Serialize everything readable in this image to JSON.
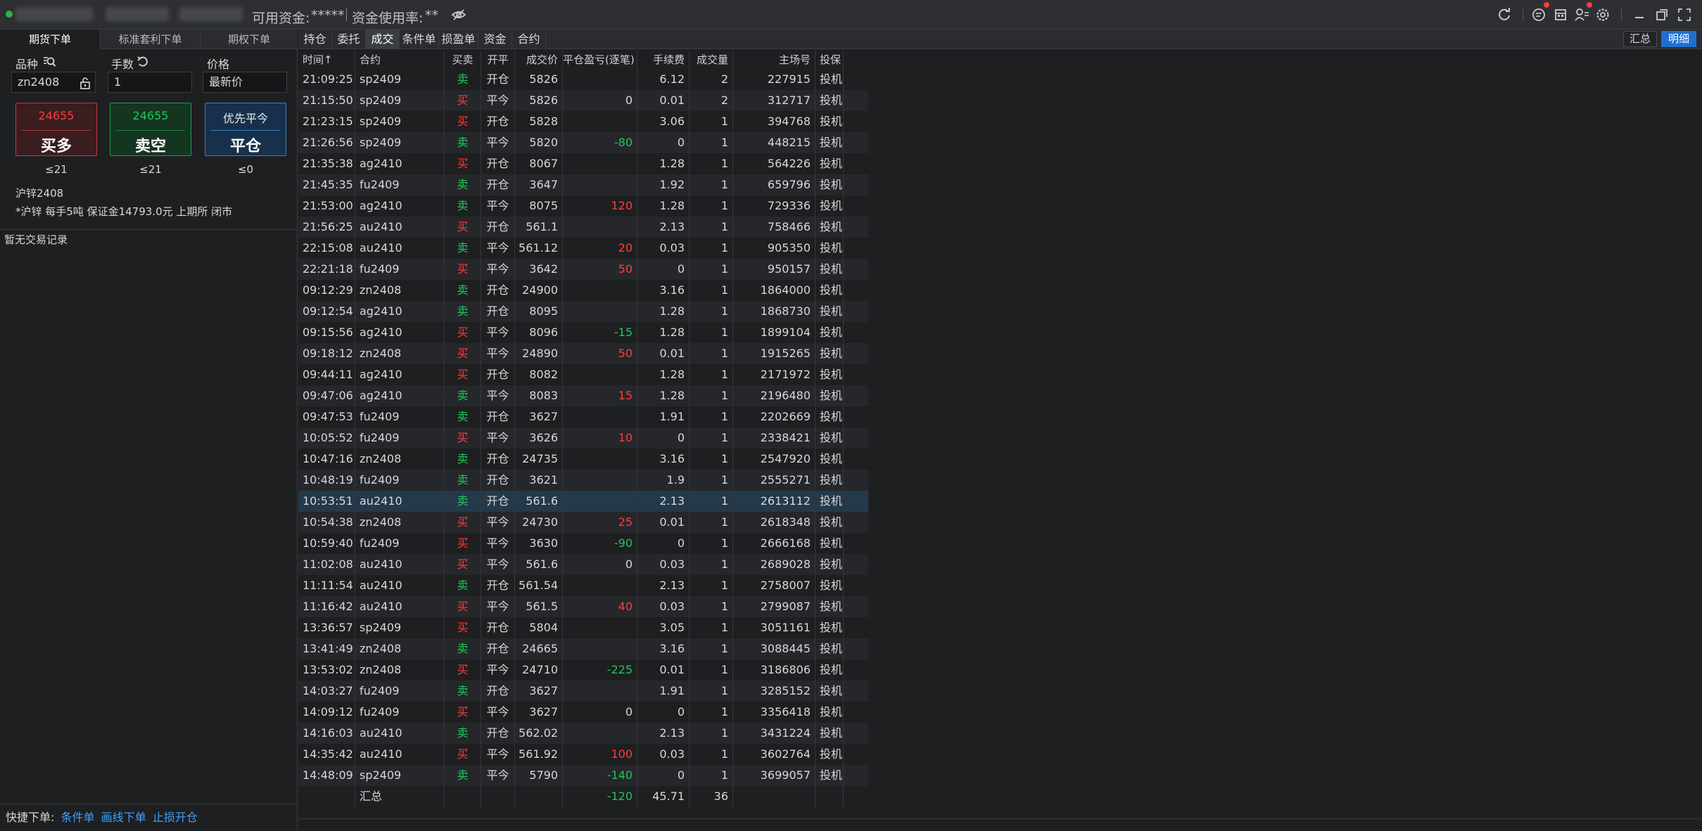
{
  "titlebar": {
    "available_funds_label": "可用资金:",
    "available_funds_value": "*****",
    "fund_usage_label": "资金使用率:",
    "fund_usage_value": "**"
  },
  "left_panel": {
    "tabs": [
      {
        "label": "期货下单",
        "active": true
      },
      {
        "label": "标准套利下单",
        "active": false
      },
      {
        "label": "期权下单",
        "active": false
      }
    ],
    "instrument_label": "品种",
    "lots_label": "手数",
    "price_label": "价格",
    "instrument_value": "zn2408",
    "lots_value": "1",
    "price_value": "最新价",
    "buttons": {
      "buy": {
        "price": "24655",
        "action": "买多",
        "limit": "≤21"
      },
      "sell": {
        "price": "24655",
        "action": "卖空",
        "limit": "≤21"
      },
      "close": {
        "price": "优先平今",
        "action": "平仓",
        "limit": "≤0"
      }
    },
    "contract_name": "沪锌2408",
    "contract_info": "*沪锌 每手5吨 保证金14793.0元 上期所 闭市",
    "no_records": "暂无交易记录",
    "quick_label": "快捷下单:",
    "quick_links": [
      "条件单",
      "画线下单",
      "止损开仓"
    ]
  },
  "right_panel": {
    "tabs": [
      "持仓",
      "委托",
      "成交",
      "条件单",
      "损盈单",
      "资金",
      "合约"
    ],
    "active_tab": "成交",
    "summary_button": "汇总",
    "detail_button": "明细",
    "columns": [
      "时间↑",
      "合约",
      "买卖",
      "开平",
      "成交价",
      "平仓盈亏(逐笔)",
      "手续费",
      "成交量",
      "主场号",
      "投保"
    ],
    "rows": [
      [
        "21:09:25",
        "sp2409",
        "卖",
        "开仓",
        "5826",
        "",
        "6.12",
        "2",
        "227915",
        "投机"
      ],
      [
        "21:15:50",
        "sp2409",
        "买",
        "平今",
        "5826",
        "0",
        "0.01",
        "2",
        "312717",
        "投机"
      ],
      [
        "21:23:15",
        "sp2409",
        "买",
        "开仓",
        "5828",
        "",
        "3.06",
        "1",
        "394768",
        "投机"
      ],
      [
        "21:26:56",
        "sp2409",
        "卖",
        "平今",
        "5820",
        "-80",
        "0",
        "1",
        "448215",
        "投机"
      ],
      [
        "21:35:38",
        "ag2410",
        "买",
        "开仓",
        "8067",
        "",
        "1.28",
        "1",
        "564226",
        "投机"
      ],
      [
        "21:45:35",
        "fu2409",
        "卖",
        "开仓",
        "3647",
        "",
        "1.92",
        "1",
        "659796",
        "投机"
      ],
      [
        "21:53:00",
        "ag2410",
        "卖",
        "平今",
        "8075",
        "120",
        "1.28",
        "1",
        "729336",
        "投机"
      ],
      [
        "21:56:25",
        "au2410",
        "买",
        "开仓",
        "561.1",
        "",
        "2.13",
        "1",
        "758466",
        "投机"
      ],
      [
        "22:15:08",
        "au2410",
        "卖",
        "平今",
        "561.12",
        "20",
        "0.03",
        "1",
        "905350",
        "投机"
      ],
      [
        "22:21:18",
        "fu2409",
        "买",
        "平今",
        "3642",
        "50",
        "0",
        "1",
        "950157",
        "投机"
      ],
      [
        "09:12:29",
        "zn2408",
        "卖",
        "开仓",
        "24900",
        "",
        "3.16",
        "1",
        "1864000",
        "投机"
      ],
      [
        "09:12:54",
        "ag2410",
        "卖",
        "开仓",
        "8095",
        "",
        "1.28",
        "1",
        "1868730",
        "投机"
      ],
      [
        "09:15:56",
        "ag2410",
        "买",
        "平今",
        "8096",
        "-15",
        "1.28",
        "1",
        "1899104",
        "投机"
      ],
      [
        "09:18:12",
        "zn2408",
        "买",
        "平今",
        "24890",
        "50",
        "0.01",
        "1",
        "1915265",
        "投机"
      ],
      [
        "09:44:11",
        "ag2410",
        "买",
        "开仓",
        "8082",
        "",
        "1.28",
        "1",
        "2171972",
        "投机"
      ],
      [
        "09:47:06",
        "ag2410",
        "卖",
        "平今",
        "8083",
        "15",
        "1.28",
        "1",
        "2196480",
        "投机"
      ],
      [
        "09:47:53",
        "fu2409",
        "卖",
        "开仓",
        "3627",
        "",
        "1.91",
        "1",
        "2202669",
        "投机"
      ],
      [
        "10:05:52",
        "fu2409",
        "买",
        "平今",
        "3626",
        "10",
        "0",
        "1",
        "2338421",
        "投机"
      ],
      [
        "10:47:16",
        "zn2408",
        "卖",
        "开仓",
        "24735",
        "",
        "3.16",
        "1",
        "2547920",
        "投机"
      ],
      [
        "10:48:19",
        "fu2409",
        "卖",
        "开仓",
        "3621",
        "",
        "1.9",
        "1",
        "2555271",
        "投机"
      ],
      [
        "10:53:51",
        "au2410",
        "卖",
        "开仓",
        "561.6",
        "",
        "2.13",
        "1",
        "2613112",
        "投机"
      ],
      [
        "10:54:38",
        "zn2408",
        "买",
        "平今",
        "24730",
        "25",
        "0.01",
        "1",
        "2618348",
        "投机"
      ],
      [
        "10:59:40",
        "fu2409",
        "买",
        "平今",
        "3630",
        "-90",
        "0",
        "1",
        "2666168",
        "投机"
      ],
      [
        "11:02:08",
        "au2410",
        "买",
        "平今",
        "561.6",
        "0",
        "0.03",
        "1",
        "2689028",
        "投机"
      ],
      [
        "11:11:54",
        "au2410",
        "卖",
        "开仓",
        "561.54",
        "",
        "2.13",
        "1",
        "2758007",
        "投机"
      ],
      [
        "11:16:42",
        "au2410",
        "买",
        "平今",
        "561.5",
        "40",
        "0.03",
        "1",
        "2799087",
        "投机"
      ],
      [
        "13:36:57",
        "sp2409",
        "买",
        "开仓",
        "5804",
        "",
        "3.05",
        "1",
        "3051161",
        "投机"
      ],
      [
        "13:41:49",
        "zn2408",
        "卖",
        "开仓",
        "24665",
        "",
        "3.16",
        "1",
        "3088445",
        "投机"
      ],
      [
        "13:53:02",
        "zn2408",
        "买",
        "平今",
        "24710",
        "-225",
        "0.01",
        "1",
        "3186806",
        "投机"
      ],
      [
        "14:03:27",
        "fu2409",
        "卖",
        "开仓",
        "3627",
        "",
        "1.91",
        "1",
        "3285152",
        "投机"
      ],
      [
        "14:09:12",
        "fu2409",
        "买",
        "平今",
        "3627",
        "0",
        "0",
        "1",
        "3356418",
        "投机"
      ],
      [
        "14:16:03",
        "au2410",
        "卖",
        "开仓",
        "562.02",
        "",
        "2.13",
        "1",
        "3431224",
        "投机"
      ],
      [
        "14:35:42",
        "au2410",
        "买",
        "平今",
        "561.92",
        "100",
        "0.03",
        "1",
        "3602764",
        "投机"
      ],
      [
        "14:48:09",
        "sp2409",
        "卖",
        "平今",
        "5790",
        "-140",
        "0",
        "1",
        "3699057",
        "投机"
      ]
    ],
    "selected_row": 20,
    "totals": {
      "label": "汇总",
      "pnl": "-120",
      "fee": "45.71",
      "volume": "36"
    }
  },
  "colors": {
    "buy": "#ff3d3d",
    "sell": "#22c55e",
    "accent": "#1f6fd1",
    "link": "#3ea1ff"
  }
}
